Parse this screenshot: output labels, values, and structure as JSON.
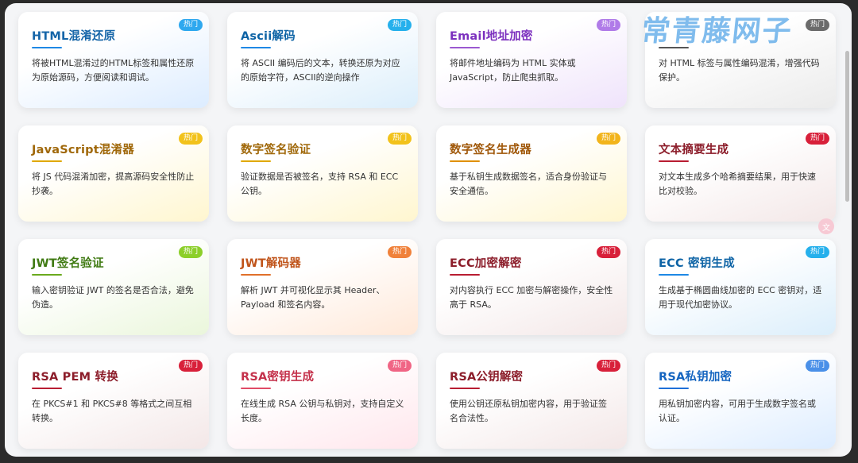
{
  "cards": [
    {
      "title": "HTML混淆还原",
      "desc": "将被HTML混淆过的HTML标签和属性还原为原始源码，方便阅读和调试。",
      "badge": "热门",
      "title_color": "#1565a8",
      "badge_color": "#2ea8ef",
      "bar_color": "#1e88e5",
      "theme": "t-blue"
    },
    {
      "title": "Ascii解码",
      "desc": "将 ASCII 编码后的文本，转换还原为对应的原始字符，ASCII的逆向操作",
      "badge": "热门",
      "title_color": "#0d63a5",
      "badge_color": "#25b0ec",
      "bar_color": "#1e88e5",
      "theme": "t-cyan"
    },
    {
      "title": "Email地址加密",
      "desc": "将邮件地址编码为 HTML 实体或 JavaScript，防止爬虫抓取。",
      "badge": "热门",
      "title_color": "#7b2fbe",
      "badge_color": "#b07be8",
      "bar_color": "#9b59d0",
      "theme": "t-purple"
    },
    {
      "title": "",
      "desc": "对 HTML 标签与属性编码混淆，增强代码保护。",
      "badge": "热门",
      "title_color": "#3a3a3a",
      "badge_color": "#6b6b6b",
      "bar_color": "#555555",
      "theme": "t-gray"
    },
    {
      "title": "JavaScript混淆器",
      "desc": "将 JS 代码混淆加密，提高源码安全性防止抄袭。",
      "badge": "热门",
      "title_color": "#a0680a",
      "badge_color": "#f2c21b",
      "bar_color": "#e0a800",
      "theme": "t-yellow"
    },
    {
      "title": "数字签名验证",
      "desc": "验证数据是否被签名，支持 RSA 和 ECC 公钥。",
      "badge": "热门",
      "title_color": "#a0680a",
      "badge_color": "#f2c21b",
      "bar_color": "#e0a800",
      "theme": "t-yellow"
    },
    {
      "title": "数字签名生成器",
      "desc": "基于私钥生成数据签名，适合身份验证与安全通信。",
      "badge": "热门",
      "title_color": "#a0580a",
      "badge_color": "#f2b41b",
      "bar_color": "#e09000",
      "theme": "t-yellow"
    },
    {
      "title": "文本摘要生成",
      "desc": "对文本生成多个哈希摘要结果，用于快速比对校验。",
      "badge": "热门",
      "title_color": "#8c1d2a",
      "badge_color": "#d8203a",
      "bar_color": "#b81d32",
      "theme": "t-rose"
    },
    {
      "title": "JWT签名验证",
      "desc": "输入密钥验证 JWT 的签名是否合法，避免伪造。",
      "badge": "热门",
      "title_color": "#3f7a12",
      "badge_color": "#8ccf2a",
      "bar_color": "#6aaa1e",
      "theme": "t-green"
    },
    {
      "title": "JWT解码器",
      "desc": "解析 JWT 并可视化显示其 Header、Payload 和签名内容。",
      "badge": "热门",
      "title_color": "#c0541a",
      "badge_color": "#f0813a",
      "bar_color": "#e0702a",
      "theme": "t-orange"
    },
    {
      "title": "ECC加密解密",
      "desc": "对内容执行 ECC 加密与解密操作，安全性高于 RSA。",
      "badge": "热门",
      "title_color": "#8c1d2a",
      "badge_color": "#d8203a",
      "bar_color": "#b81d32",
      "theme": "t-rose"
    },
    {
      "title": "ECC 密钥生成",
      "desc": "生成基于椭圆曲线加密的 ECC 密钥对，适用于现代加密协议。",
      "badge": "热门",
      "title_color": "#0d63a5",
      "badge_color": "#25b0ec",
      "bar_color": "#1e88e5",
      "theme": "t-cyan"
    },
    {
      "title": "RSA PEM 转换",
      "desc": "在 PKCS#1 和 PKCS#8 等格式之间互相转换。",
      "badge": "热门",
      "title_color": "#8c1d2a",
      "badge_color": "#d8203a",
      "bar_color": "#b81d32",
      "theme": "t-rose"
    },
    {
      "title": "RSA密钥生成",
      "desc": "在线生成 RSA 公钥与私钥对，支持自定义长度。",
      "badge": "热门",
      "title_color": "#c4314b",
      "badge_color": "#f06585",
      "bar_color": "#e04a66",
      "theme": "t-pink"
    },
    {
      "title": "RSA公钥解密",
      "desc": "使用公钥还原私钥加密内容，用于验证签名合法性。",
      "badge": "热门",
      "title_color": "#8c1d2a",
      "badge_color": "#d8203a",
      "bar_color": "#b81d32",
      "theme": "t-rose"
    },
    {
      "title": "RSA私钥加密",
      "desc": "用私钥加密内容，可用于生成数字签名或认证。",
      "badge": "热门",
      "title_color": "#1565c0",
      "badge_color": "#4a90e8",
      "bar_color": "#1e6fd8",
      "theme": "t-blue"
    }
  ],
  "watermark": "常青藤网子",
  "float_button": {
    "icon": "translate-icon",
    "label": "文"
  }
}
